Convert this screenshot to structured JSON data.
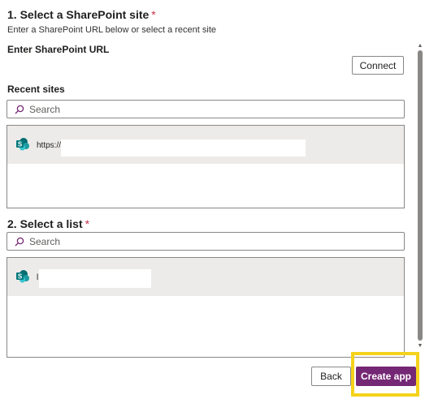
{
  "section1": {
    "title": "1. Select a SharePoint site",
    "required_mark": "*",
    "hint": "Enter a SharePoint URL below or select a recent site",
    "url_label": "Enter SharePoint URL",
    "connect_label": "Connect",
    "recent_label": "Recent sites",
    "search_placeholder": "Search",
    "recent_items": [
      {
        "text": "https://r"
      }
    ]
  },
  "section2": {
    "title": "2. Select a list",
    "required_mark": "*",
    "search_placeholder": "Search",
    "list_items": [
      {
        "text": "l"
      }
    ]
  },
  "footer": {
    "back_label": "Back",
    "create_label": "Create app"
  },
  "colors": {
    "accent": "#742774",
    "required": "#c4314b",
    "highlight": "#f5d21b",
    "selected_row": "#edebe9",
    "sharepoint": "#038387"
  },
  "icons": {
    "search": "search-icon",
    "site": "sharepoint-icon"
  }
}
